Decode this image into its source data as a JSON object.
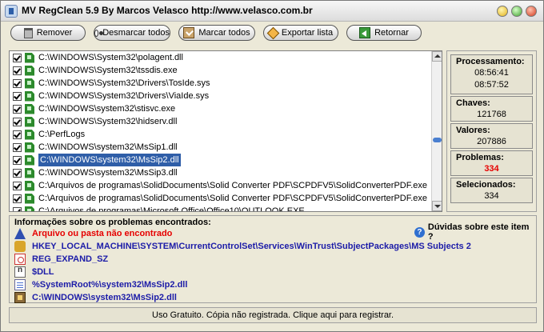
{
  "window": {
    "title": "MV RegClean 5.9   By Marcos Velasco   http://www.velasco.com.br"
  },
  "toolbar": {
    "remove_label": "Remover",
    "unmark_label": "Desmarcar todos",
    "markall_label": "Marcar todos",
    "export_label": "Exportar lista",
    "back_label": "Retornar"
  },
  "list": {
    "items": [
      {
        "text": "C:\\WINDOWS\\System32\\polagent.dll",
        "checked": true
      },
      {
        "text": "C:\\WINDOWS\\System32\\tssdis.exe",
        "checked": true
      },
      {
        "text": "C:\\WINDOWS\\System32\\Drivers\\TosIde.sys",
        "checked": true
      },
      {
        "text": "C:\\WINDOWS\\System32\\Drivers\\ViaIde.sys",
        "checked": true
      },
      {
        "text": "C:\\WINDOWS\\system32\\stisvc.exe",
        "checked": true
      },
      {
        "text": "C:\\WINDOWS\\System32\\hidserv.dll",
        "checked": true
      },
      {
        "text": "C:\\PerfLogs",
        "checked": true
      },
      {
        "text": "C:\\WINDOWS\\system32\\MsSip1.dll",
        "checked": true
      },
      {
        "text": "C:\\WINDOWS\\system32\\MsSip2.dll",
        "checked": true,
        "selected": true
      },
      {
        "text": "C:\\WINDOWS\\system32\\MsSip3.dll",
        "checked": true
      },
      {
        "text": "C:\\Arquivos de programas\\SolidDocuments\\Solid Converter PDF\\SCPDFV5\\SolidConverterPDF.exe",
        "checked": true
      },
      {
        "text": "C:\\Arquivos de programas\\SolidDocuments\\Solid Converter PDF\\SCPDFV5\\SolidConverterPDF.exe",
        "checked": true
      },
      {
        "text": "C:\\Arquivos de programas\\Microsoft Office\\Office10\\OUTLOOK.EXE",
        "checked": true
      }
    ]
  },
  "stats": {
    "processing_label": "Processamento:",
    "processing_start": "08:56:41",
    "processing_end": "08:57:52",
    "keys_label": "Chaves:",
    "keys_value": "121768",
    "values_label": "Valores:",
    "values_value": "207886",
    "problems_label": "Problemas:",
    "problems_value": "334",
    "selected_label": "Selecionados:",
    "selected_value": "334"
  },
  "info": {
    "title": "Informações sobre os problemas encontrados:",
    "help_label": "Dúvidas sobre este item ?",
    "error_text": "Arquivo ou pasta não encontrado",
    "key_path": "HKEY_LOCAL_MACHINE\\SYSTEM\\CurrentControlSet\\Services\\WinTrust\\SubjectPackages\\MS Subjects 2",
    "value_type": "REG_EXPAND_SZ",
    "value_name": "$DLL",
    "value_data": "%SystemRoot%\\system32\\MsSip2.dll",
    "file_path": "C:\\WINDOWS\\system32\\MsSip2.dll"
  },
  "status": {
    "text": "Uso Gratuito.  Cópia não registrada.  Clique aqui para registrar."
  },
  "colors": {
    "selection": "#2f5ea8",
    "problems": "#e60000",
    "info_blue": "#1c1ca8"
  }
}
